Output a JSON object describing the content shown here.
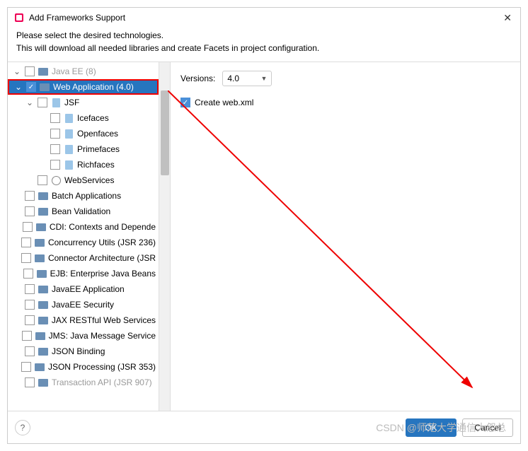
{
  "title": "Add Frameworks Support",
  "intro_line1": "Please select the desired technologies.",
  "intro_line2": "This will download all needed libraries and create Facets in project configuration.",
  "versions_label": "Versions:",
  "version_value": "4.0",
  "create_webxml_label": "Create web.xml",
  "ok_label": "OK",
  "cancel_label": "Cancel",
  "watermark": "CSDN @师范大学通信大怨总",
  "tree": [
    {
      "indent": 0,
      "expand": "v",
      "checked": false,
      "icon": "folder",
      "label": "Java EE (8)",
      "disabled": true
    },
    {
      "indent": 0,
      "expand": "v",
      "checked": true,
      "icon": "folder",
      "label": "Web Application (4.0)",
      "selected": true,
      "redbox": true
    },
    {
      "indent": 1,
      "expand": "v",
      "checked": false,
      "icon": "doc",
      "label": "JSF"
    },
    {
      "indent": 2,
      "expand": "",
      "checked": false,
      "icon": "doc",
      "label": "Icefaces"
    },
    {
      "indent": 2,
      "expand": "",
      "checked": false,
      "icon": "doc",
      "label": "Openfaces"
    },
    {
      "indent": 2,
      "expand": "",
      "checked": false,
      "icon": "doc",
      "label": "Primefaces"
    },
    {
      "indent": 2,
      "expand": "",
      "checked": false,
      "icon": "doc",
      "label": "Richfaces"
    },
    {
      "indent": 1,
      "expand": "",
      "checked": false,
      "icon": "globe",
      "label": "WebServices"
    },
    {
      "indent": 0,
      "expand": "",
      "checked": false,
      "icon": "folder",
      "label": "Batch Applications"
    },
    {
      "indent": 0,
      "expand": "",
      "checked": false,
      "icon": "folder",
      "label": "Bean Validation"
    },
    {
      "indent": 0,
      "expand": "",
      "checked": false,
      "icon": "folder",
      "label": "CDI: Contexts and Depende"
    },
    {
      "indent": 0,
      "expand": "",
      "checked": false,
      "icon": "folder",
      "label": "Concurrency Utils (JSR 236)"
    },
    {
      "indent": 0,
      "expand": "",
      "checked": false,
      "icon": "folder",
      "label": "Connector Architecture (JSR"
    },
    {
      "indent": 0,
      "expand": "",
      "checked": false,
      "icon": "folder",
      "label": "EJB: Enterprise Java Beans"
    },
    {
      "indent": 0,
      "expand": "",
      "checked": false,
      "icon": "folder",
      "label": "JavaEE Application"
    },
    {
      "indent": 0,
      "expand": "",
      "checked": false,
      "icon": "folder",
      "label": "JavaEE Security"
    },
    {
      "indent": 0,
      "expand": "",
      "checked": false,
      "icon": "folder",
      "label": "JAX RESTful Web Services"
    },
    {
      "indent": 0,
      "expand": "",
      "checked": false,
      "icon": "folder",
      "label": "JMS: Java Message Service"
    },
    {
      "indent": 0,
      "expand": "",
      "checked": false,
      "icon": "folder",
      "label": "JSON Binding"
    },
    {
      "indent": 0,
      "expand": "",
      "checked": false,
      "icon": "folder",
      "label": "JSON Processing (JSR 353)"
    },
    {
      "indent": 0,
      "expand": "",
      "checked": false,
      "icon": "folder",
      "label": "Transaction API (JSR 907)",
      "disabled": true
    }
  ]
}
